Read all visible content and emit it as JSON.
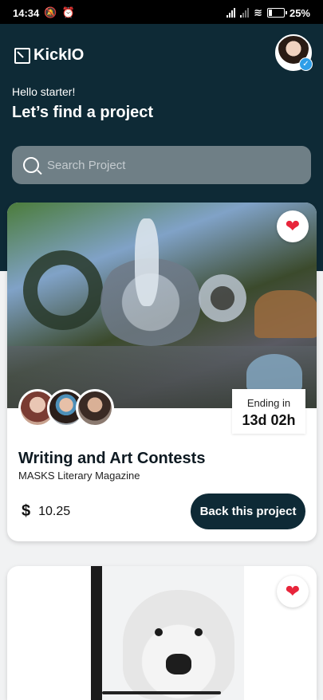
{
  "status_bar": {
    "time": "14:34",
    "battery": "25%",
    "battery_level": 0.25
  },
  "header": {
    "logo_text": "KickIO",
    "greeting": "Hello starter!",
    "headline": "Let’s find a project"
  },
  "search": {
    "placeholder": "Search Project"
  },
  "projects": [
    {
      "title": "Writing and Art Contests",
      "organization": "MASKS Literary Magazine",
      "amount": "10.25",
      "currency_icon": "$",
      "ending_label": "Ending in",
      "ending_value": "13d 02h",
      "cta_label": "Back this project",
      "favorited": true
    },
    {
      "favorited": true
    }
  ],
  "colors": {
    "primary_dark": "#0e2a36",
    "heart": "#e8253b",
    "background": "#f1f2f3"
  }
}
